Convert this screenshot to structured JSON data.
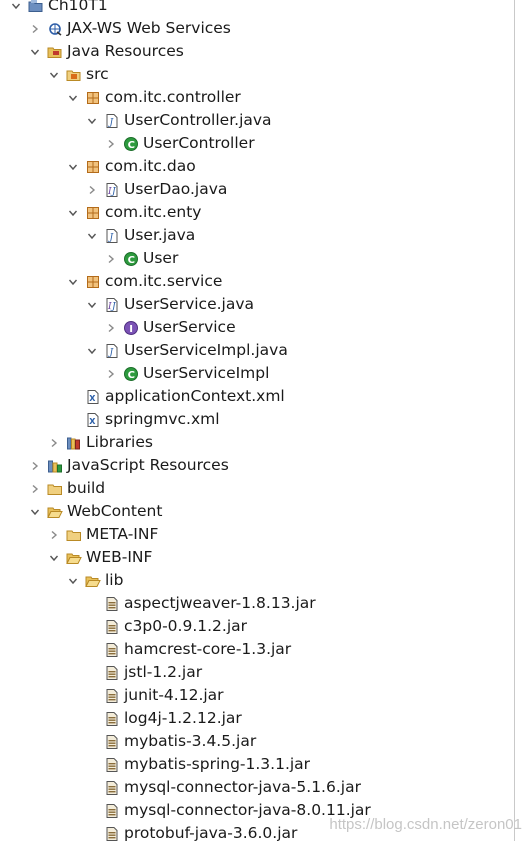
{
  "tree": [
    {
      "name": "project-ch10t1",
      "label": "Ch10T1",
      "depth": 0,
      "twisty": "expanded",
      "icon": "project-icon"
    },
    {
      "name": "node-jax-ws",
      "label": "JAX-WS Web Services",
      "depth": 1,
      "twisty": "collapsed",
      "icon": "webservice-icon"
    },
    {
      "name": "node-java-resources",
      "label": "Java Resources",
      "depth": 1,
      "twisty": "expanded",
      "icon": "java-resources-icon"
    },
    {
      "name": "node-src",
      "label": "src",
      "depth": 2,
      "twisty": "expanded",
      "icon": "source-folder-icon"
    },
    {
      "name": "pkg-controller",
      "label": "com.itc.controller",
      "depth": 3,
      "twisty": "expanded",
      "icon": "package-icon"
    },
    {
      "name": "file-usercontroller-java",
      "label": "UserController.java",
      "depth": 4,
      "twisty": "expanded",
      "icon": "java-file-icon"
    },
    {
      "name": "class-usercontroller",
      "label": "UserController",
      "depth": 5,
      "twisty": "collapsed",
      "icon": "class-icon"
    },
    {
      "name": "pkg-dao",
      "label": "com.itc.dao",
      "depth": 3,
      "twisty": "expanded",
      "icon": "package-icon"
    },
    {
      "name": "file-userdao-java",
      "label": "UserDao.java",
      "depth": 4,
      "twisty": "collapsed",
      "icon": "java-interface-file-icon"
    },
    {
      "name": "pkg-enty",
      "label": "com.itc.enty",
      "depth": 3,
      "twisty": "expanded",
      "icon": "package-icon"
    },
    {
      "name": "file-user-java",
      "label": "User.java",
      "depth": 4,
      "twisty": "expanded",
      "icon": "java-file-icon"
    },
    {
      "name": "class-user",
      "label": "User",
      "depth": 5,
      "twisty": "collapsed",
      "icon": "class-icon"
    },
    {
      "name": "pkg-service",
      "label": "com.itc.service",
      "depth": 3,
      "twisty": "expanded",
      "icon": "package-icon"
    },
    {
      "name": "file-userservice-java",
      "label": "UserService.java",
      "depth": 4,
      "twisty": "expanded",
      "icon": "java-interface-file-icon"
    },
    {
      "name": "interface-userservice",
      "label": "UserService",
      "depth": 5,
      "twisty": "collapsed",
      "icon": "interface-icon"
    },
    {
      "name": "file-userserviceimpl-java",
      "label": "UserServiceImpl.java",
      "depth": 4,
      "twisty": "expanded",
      "icon": "java-file-icon"
    },
    {
      "name": "class-userserviceimpl",
      "label": "UserServiceImpl",
      "depth": 5,
      "twisty": "collapsed",
      "icon": "class-icon"
    },
    {
      "name": "file-applicationcontext-xml",
      "label": "applicationContext.xml",
      "depth": 3,
      "twisty": "none",
      "icon": "xml-file-icon"
    },
    {
      "name": "file-springmvc-xml",
      "label": "springmvc.xml",
      "depth": 3,
      "twisty": "none",
      "icon": "xml-file-icon"
    },
    {
      "name": "node-libraries",
      "label": "Libraries",
      "depth": 2,
      "twisty": "collapsed",
      "icon": "libraries-icon"
    },
    {
      "name": "node-javascript-resources",
      "label": "JavaScript Resources",
      "depth": 1,
      "twisty": "collapsed",
      "icon": "javascript-resources-icon"
    },
    {
      "name": "folder-build",
      "label": "build",
      "depth": 1,
      "twisty": "collapsed",
      "icon": "folder-icon"
    },
    {
      "name": "folder-webcontent",
      "label": "WebContent",
      "depth": 1,
      "twisty": "expanded",
      "icon": "open-folder-icon"
    },
    {
      "name": "folder-meta-inf",
      "label": "META-INF",
      "depth": 2,
      "twisty": "collapsed",
      "icon": "folder-icon"
    },
    {
      "name": "folder-web-inf",
      "label": "WEB-INF",
      "depth": 2,
      "twisty": "expanded",
      "icon": "open-folder-icon"
    },
    {
      "name": "folder-lib",
      "label": "lib",
      "depth": 3,
      "twisty": "expanded",
      "icon": "open-folder-icon"
    },
    {
      "name": "jar-aspectjweaver",
      "label": "aspectjweaver-1.8.13.jar",
      "depth": 4,
      "twisty": "none",
      "icon": "jar-icon"
    },
    {
      "name": "jar-c3p0",
      "label": "c3p0-0.9.1.2.jar",
      "depth": 4,
      "twisty": "none",
      "icon": "jar-icon"
    },
    {
      "name": "jar-hamcrest",
      "label": "hamcrest-core-1.3.jar",
      "depth": 4,
      "twisty": "none",
      "icon": "jar-icon"
    },
    {
      "name": "jar-jstl",
      "label": "jstl-1.2.jar",
      "depth": 4,
      "twisty": "none",
      "icon": "jar-icon"
    },
    {
      "name": "jar-junit",
      "label": "junit-4.12.jar",
      "depth": 4,
      "twisty": "none",
      "icon": "jar-icon"
    },
    {
      "name": "jar-log4j",
      "label": "log4j-1.2.12.jar",
      "depth": 4,
      "twisty": "none",
      "icon": "jar-icon"
    },
    {
      "name": "jar-mybatis",
      "label": "mybatis-3.4.5.jar",
      "depth": 4,
      "twisty": "none",
      "icon": "jar-icon"
    },
    {
      "name": "jar-mybatis-spring",
      "label": "mybatis-spring-1.3.1.jar",
      "depth": 4,
      "twisty": "none",
      "icon": "jar-icon"
    },
    {
      "name": "jar-mysql-connector-5",
      "label": "mysql-connector-java-5.1.6.jar",
      "depth": 4,
      "twisty": "none",
      "icon": "jar-icon"
    },
    {
      "name": "jar-mysql-connector-8",
      "label": "mysql-connector-java-8.0.11.jar",
      "depth": 4,
      "twisty": "none",
      "icon": "jar-icon"
    },
    {
      "name": "jar-protobuf",
      "label": "protobuf-java-3.6.0.jar",
      "depth": 4,
      "twisty": "none",
      "icon": "jar-icon"
    }
  ],
  "watermark": "https://blog.csdn.net/zeron01",
  "colors": {
    "twisty": "#555555",
    "package": "#b36b1a",
    "class_badge": "#2d9a3e",
    "interface_badge": "#6b3fa0",
    "folder": "#e8c05a",
    "jar": "#8a6d3b"
  }
}
